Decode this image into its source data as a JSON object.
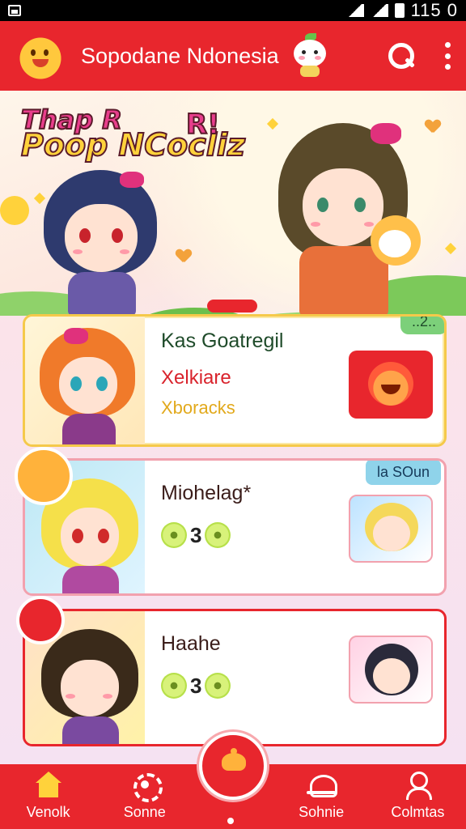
{
  "status_bar": {
    "time": "115 0"
  },
  "app_bar": {
    "title": "Sopodane Ndonesia"
  },
  "hero": {
    "title_line1": "Thap R",
    "title_line2": "Poop NCocliz",
    "title_accent": "R!"
  },
  "cards": [
    {
      "title": "Kas Goatregil",
      "subtitle1": "Xelkiare",
      "subtitle2": "Xboracks",
      "badge": "..2.."
    },
    {
      "title": "Miohelag*",
      "rating": "3",
      "badge": "la SOun"
    },
    {
      "title": "Haahe",
      "rating": "3"
    }
  ],
  "bottom_nav": {
    "items": [
      {
        "label": "Venolk",
        "icon": "home-icon"
      },
      {
        "label": "Sonne",
        "icon": "flower-icon"
      },
      {
        "label": "Sohnie",
        "icon": "cap-icon"
      },
      {
        "label": "Colmtas",
        "icon": "user-icon"
      }
    ],
    "fab_icon": "basket-icon"
  },
  "colors": {
    "primary": "#e8262d",
    "accent_yellow": "#ffd23b",
    "card_gold_border": "#f5c94a",
    "card_pink_border": "#f2a1ae"
  }
}
